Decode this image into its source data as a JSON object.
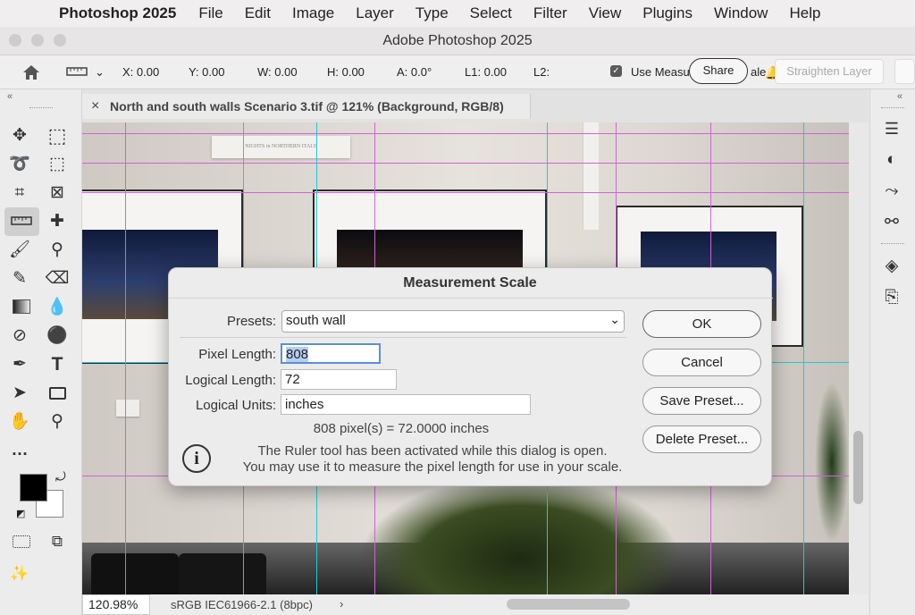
{
  "menubar": {
    "app": "Photoshop 2025",
    "items": [
      "File",
      "Edit",
      "Image",
      "Layer",
      "Type",
      "Select",
      "Filter",
      "View",
      "Plugins",
      "Window",
      "Help"
    ]
  },
  "window": {
    "title": "Adobe Photoshop 2025"
  },
  "options": {
    "x": "X: 0.00",
    "y": "Y: 0.00",
    "w": "W: 0.00",
    "h": "H: 0.00",
    "a": "A: 0.0°",
    "l1": "L1: 0.00",
    "l2": "L2:",
    "use_measure": "Use Measu",
    "scale_tail": "ale",
    "share": "Share",
    "straighten": "Straighten Layer"
  },
  "document": {
    "tab_title": "North and south walls Scenario 3.tif @ 121% (Background, RGB/8)",
    "close": "×",
    "placard": "NIGHTS in NORTHERN ITALY"
  },
  "dialog": {
    "title": "Measurement Scale",
    "presets_label": "Presets:",
    "presets_value": "south wall",
    "pixel_length_label": "Pixel Length:",
    "pixel_length": "808",
    "logical_length_label": "Logical Length:",
    "logical_length": "72",
    "logical_units_label": "Logical Units:",
    "logical_units": "inches",
    "result": "808 pixel(s) = 72.0000 inches",
    "info_line1": "The Ruler tool has been activated while this dialog is open.",
    "info_line2": "You may use it to measure the pixel length for use in your scale.",
    "ok": "OK",
    "cancel": "Cancel",
    "save_preset": "Save Preset...",
    "delete_preset": "Delete Preset..."
  },
  "status": {
    "zoom": "120.98%",
    "profile": "sRGB IEC61966-2.1 (8bpc)"
  },
  "colors": {
    "guide_cyan": "#23c8d8",
    "guide_magenta": "#d262d8",
    "foreground": "#000000",
    "background": "#ffffff"
  }
}
